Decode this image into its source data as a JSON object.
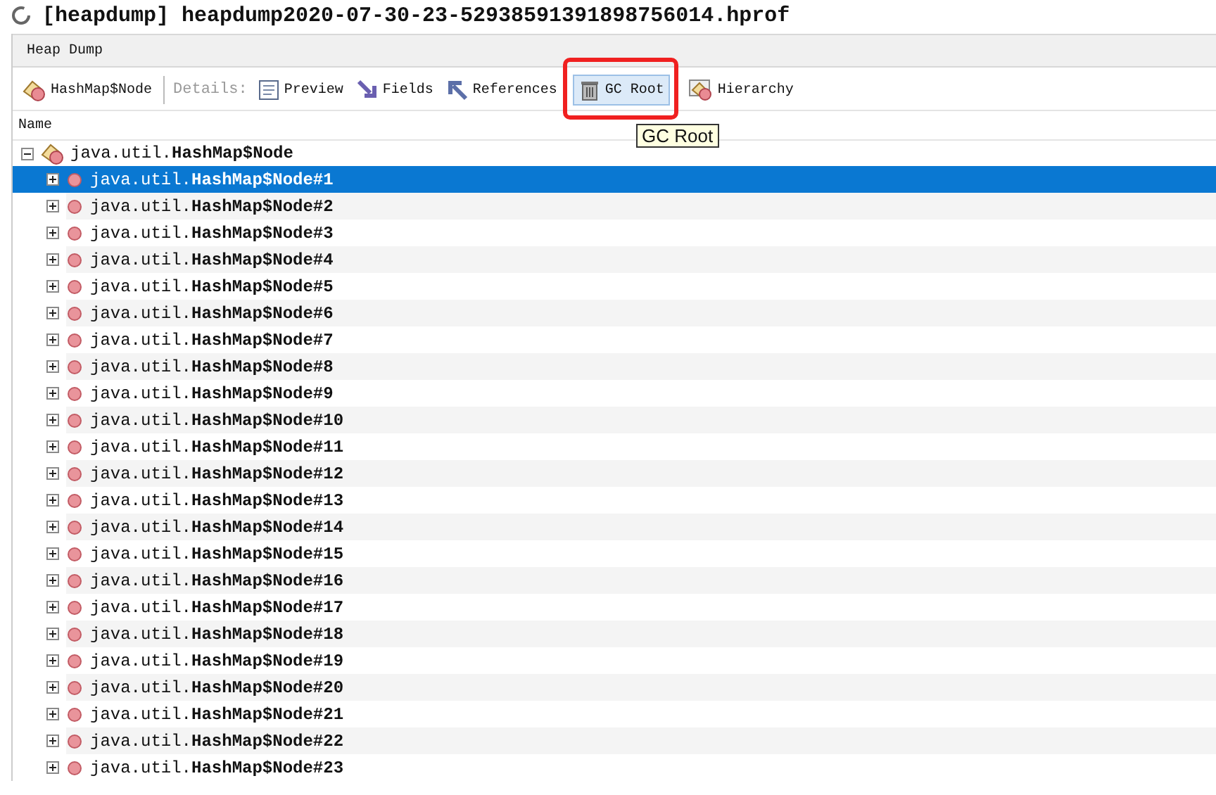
{
  "window": {
    "title": "[heapdump] heapdump2020-07-30-23-52938591391898756014.hprof"
  },
  "tabs": [
    {
      "label": "Heap Dump",
      "selected": true
    }
  ],
  "toolbar": {
    "object": "HashMap$Node",
    "details_label": "Details:",
    "buttons": [
      {
        "kind": "preview",
        "label": "Preview",
        "highlighted": false
      },
      {
        "kind": "fields",
        "label": "Fields",
        "highlighted": false
      },
      {
        "kind": "references",
        "label": "References",
        "highlighted": false
      },
      {
        "kind": "gcroot",
        "label": "GC Root",
        "highlighted": true
      },
      {
        "kind": "hierarchy",
        "label": "Hierarchy",
        "highlighted": false
      }
    ]
  },
  "tooltip": "GC Root",
  "table": {
    "columns": [
      "Name"
    ],
    "root": {
      "label": "java.util.**HashMap$Node**",
      "expanded": true,
      "children": [
        {
          "label": "java.util.**HashMap$Node#1**",
          "selected": true,
          "expanded": false
        },
        {
          "label": "java.util.**HashMap$Node#2**",
          "selected": false,
          "expanded": false
        },
        {
          "label": "java.util.**HashMap$Node#3**",
          "selected": false,
          "expanded": false
        },
        {
          "label": "java.util.**HashMap$Node#4**",
          "selected": false,
          "expanded": false
        },
        {
          "label": "java.util.**HashMap$Node#5**",
          "selected": false,
          "expanded": false
        },
        {
          "label": "java.util.**HashMap$Node#6**",
          "selected": false,
          "expanded": false
        },
        {
          "label": "java.util.**HashMap$Node#7**",
          "selected": false,
          "expanded": false
        },
        {
          "label": "java.util.**HashMap$Node#8**",
          "selected": false,
          "expanded": false
        },
        {
          "label": "java.util.**HashMap$Node#9**",
          "selected": false,
          "expanded": false
        },
        {
          "label": "java.util.**HashMap$Node#10**",
          "selected": false,
          "expanded": false
        },
        {
          "label": "java.util.**HashMap$Node#11**",
          "selected": false,
          "expanded": false
        },
        {
          "label": "java.util.**HashMap$Node#12**",
          "selected": false,
          "expanded": false
        },
        {
          "label": "java.util.**HashMap$Node#13**",
          "selected": false,
          "expanded": false
        },
        {
          "label": "java.util.**HashMap$Node#14**",
          "selected": false,
          "expanded": false
        },
        {
          "label": "java.util.**HashMap$Node#15**",
          "selected": false,
          "expanded": false
        },
        {
          "label": "java.util.**HashMap$Node#16**",
          "selected": false,
          "expanded": false
        },
        {
          "label": "java.util.**HashMap$Node#17**",
          "selected": false,
          "expanded": false
        },
        {
          "label": "java.util.**HashMap$Node#18**",
          "selected": false,
          "expanded": false
        },
        {
          "label": "java.util.**HashMap$Node#19**",
          "selected": false,
          "expanded": false
        },
        {
          "label": "java.util.**HashMap$Node#20**",
          "selected": false,
          "expanded": false
        },
        {
          "label": "java.util.**HashMap$Node#21**",
          "selected": false,
          "expanded": false
        },
        {
          "label": "java.util.**HashMap$Node#22**",
          "selected": false,
          "expanded": false
        },
        {
          "label": "java.util.**HashMap$Node#23**",
          "selected": false,
          "expanded": false
        }
      ]
    }
  }
}
